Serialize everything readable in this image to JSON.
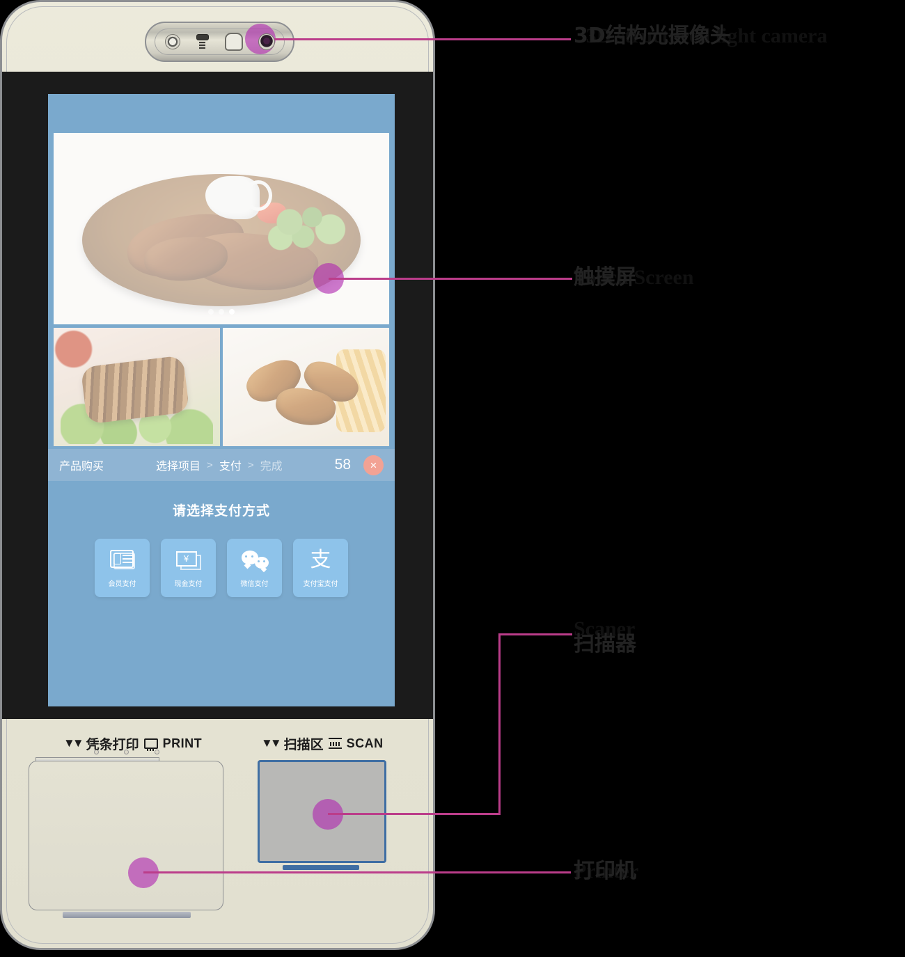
{
  "device": {
    "camera_module": {
      "parts": [
        "lens-ring",
        "ir-emitter",
        "speaker",
        "ir-camera-lens"
      ]
    },
    "screen": {
      "carousel": {
        "dots": 3,
        "active_index": 2
      },
      "thumbnails": [
        "roast-duck-platter",
        "fried-chicken-and-fries"
      ],
      "breadcrumb": {
        "title": "产品购买",
        "steps": [
          "选择项目",
          "支付",
          "完成"
        ],
        "separator": ">",
        "active_step_index": 1,
        "count": "58",
        "close_label": "×"
      },
      "payment": {
        "title": "请选择支付方式",
        "methods": [
          {
            "label": "会员支付",
            "icon": "member-card-icon"
          },
          {
            "label": "现金支付",
            "icon": "cash-note-icon"
          },
          {
            "label": "微信支付",
            "icon": "wechat-icon"
          },
          {
            "label": "支付宝支付",
            "icon": "alipay-icon"
          }
        ]
      }
    },
    "bottom_labels": {
      "print": {
        "zh": "凭条打印",
        "en": "PRINT",
        "chevron": "▼▼",
        "icon": "printer-icon"
      },
      "scan": {
        "zh": "扫描区",
        "en": "SCAN",
        "chevron": "▼▼",
        "icon": "scanner-icon"
      }
    }
  },
  "annotations": [
    {
      "id": "camera",
      "en": "3D structured light camera",
      "zh": "3D结构光摄像头"
    },
    {
      "id": "screen",
      "en": "Touch Screen",
      "zh": "触摸屏"
    },
    {
      "id": "scanner",
      "en": "Scaner",
      "zh": "扫描器"
    },
    {
      "id": "printer",
      "en": "Printer",
      "zh": "打印机"
    }
  ],
  "colors": {
    "marker": "#b028b0",
    "lead_line": "#bb3d8a",
    "screen_blue": "#7aa9cd",
    "crumb_blue": "#8fb4d3",
    "pay_card": "#8ec3ea",
    "close_pink": "#f2a294",
    "device_body": "#e6e4d4",
    "bezel": "#1b1b1b",
    "scanner_border": "#3f6ea3",
    "background": "#000000"
  }
}
